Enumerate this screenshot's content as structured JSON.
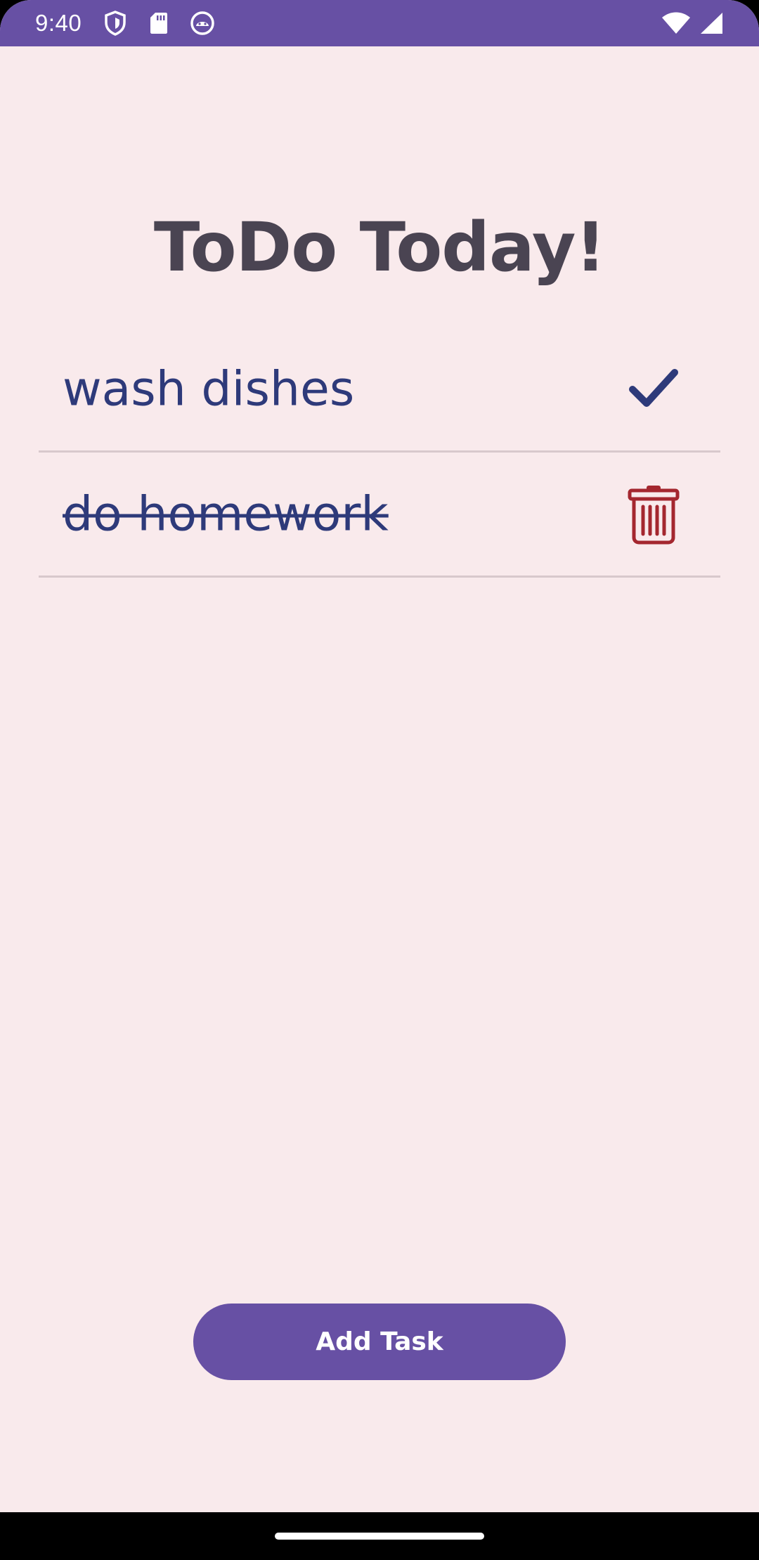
{
  "status_bar": {
    "time": "9:40",
    "left_icons": [
      "shield-icon",
      "sd-card-icon",
      "android-face-icon"
    ],
    "right_icons": [
      "wifi-icon",
      "cell-signal-icon"
    ]
  },
  "title": "ToDo Today!",
  "tasks": [
    {
      "label": "wash dishes",
      "completed": false,
      "action_icon": "checkmark-icon"
    },
    {
      "label": "do homework",
      "completed": true,
      "action_icon": "trash-icon"
    }
  ],
  "add_button_label": "Add Task",
  "colors": {
    "accent": "#6750a4",
    "background": "#f9eaec",
    "task_text": "#2e3a7a",
    "title_text": "#4a4452",
    "delete": "#a4272f",
    "check": "#2e3a7a"
  }
}
